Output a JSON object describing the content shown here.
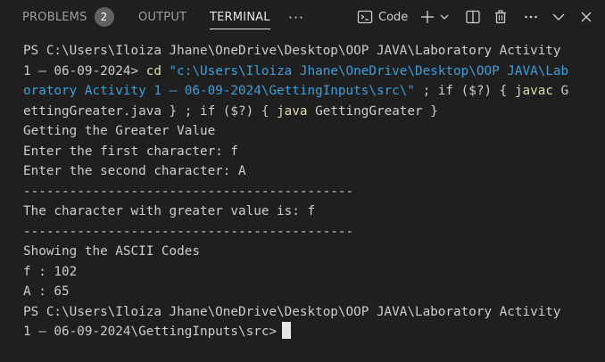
{
  "tabs": [
    {
      "label": "PROBLEMS",
      "badge": "2"
    },
    {
      "label": "OUTPUT"
    },
    {
      "label": "TERMINAL"
    }
  ],
  "more_label": "···",
  "toolbar": {
    "terminal_icon": "terminal-icon",
    "shell_label": "Code",
    "icons": [
      "terminal-icon",
      "plus-icon",
      "chevron-down-icon",
      "split-icon",
      "trash-icon",
      "more-icon",
      "chevron-down-icon",
      "close-icon"
    ]
  },
  "colors": {
    "background": "#1f1f1f",
    "text": "#cccccc",
    "command": "#dcdcaa",
    "string": "#3b9fd8"
  },
  "terminal": {
    "l1": "PS C:\\Users\\Iloiza Jhane\\OneDrive\\Desktop\\OOP JAVA\\Laboratory Activity",
    "l2_prompt": "1 – 06-09-2024> ",
    "l2_cmd": "cd",
    "l2_str": " \"c:\\Users\\Iloiza Jhane\\OneDrive\\Desktop\\OOP JAVA\\Lab",
    "l3_str": "oratory Activity 1 – 06-09-2024\\GettingInputs\\src\\\"",
    "l3_a": " ; ",
    "l3_if": "if",
    "l3_b": " ($?) { ",
    "l3_javac": "javac",
    "l3_c": " G",
    "l4_a": "ettingGreater.java } ; ",
    "l4_if": "if",
    "l4_b": " ($?) { ",
    "l4_java": "java",
    "l4_c": " GettingGreater }",
    "l5": "Getting the Greater Value",
    "l6": "Enter the first character: f",
    "l7": "Enter the second character: A",
    "l8": "-------------------------------------------",
    "l9": "The character with greater value is: f",
    "l10": "-------------------------------------------",
    "l11": "Showing the ASCII Codes",
    "l12": "f : 102",
    "l13": "A : 65",
    "l14": "PS C:\\Users\\Iloiza Jhane\\OneDrive\\Desktop\\OOP JAVA\\Laboratory Activity",
    "l15": "1 – 06-09-2024\\GettingInputs\\src>"
  }
}
